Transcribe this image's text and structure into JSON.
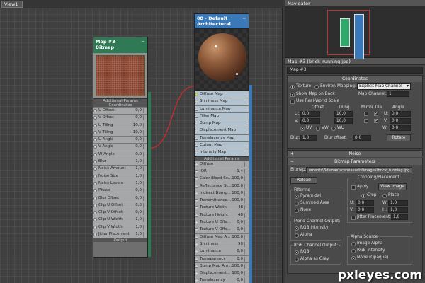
{
  "view": {
    "tab": "View1"
  },
  "bitmap_node": {
    "title": "Map #3",
    "subtitle": "Bitmap",
    "section_params": "Additional Params",
    "section_coords": "Coordinates",
    "section_output": "Output",
    "rows": [
      {
        "label": "U Offset",
        "value": "0,0"
      },
      {
        "label": "V Offset",
        "value": "0,0"
      },
      {
        "label": "U Tiling",
        "value": "10,0"
      },
      {
        "label": "V Tiling",
        "value": "10,0"
      },
      {
        "label": "U Angle",
        "value": "0,0"
      },
      {
        "label": "V Angle",
        "value": "0,0"
      },
      {
        "label": "W Angle",
        "value": "0,0"
      },
      {
        "label": "Blur",
        "value": "1,0"
      },
      {
        "label": "Noise Amount",
        "value": "1,0"
      },
      {
        "label": "Noise Size",
        "value": "1,0"
      },
      {
        "label": "Noise Levels",
        "value": "1,0"
      },
      {
        "label": "Phase",
        "value": "0,0"
      },
      {
        "label": "Blur Offset",
        "value": "0,0"
      },
      {
        "label": "Clip U Offset",
        "value": "0,0"
      },
      {
        "label": "Clip V Offset",
        "value": "0,0"
      },
      {
        "label": "Clip U Width",
        "value": "1,0"
      },
      {
        "label": "Clip V Width",
        "value": "1,0"
      },
      {
        "label": "Jitter Placement",
        "value": "1,0"
      }
    ]
  },
  "material_node": {
    "title": "08 - Default",
    "subtitle": "Architectural",
    "section_params": "Additional Params",
    "maps": [
      "Diffuse Map",
      "Shininess Map",
      "Luminance Map",
      "Filter Map",
      "Bump Map",
      "Displacement Map",
      "Translucency Map",
      "Cutout Map",
      "Intensity Map"
    ],
    "params": [
      {
        "label": "Diffuse",
        "value": ""
      },
      {
        "label": "IOR",
        "value": "1,4"
      },
      {
        "label": "Color Bleed Sc...",
        "value": "100,0"
      },
      {
        "label": "Reflectance Sc...",
        "value": "100,0"
      },
      {
        "label": "Indirect Bump...",
        "value": "100,0"
      },
      {
        "label": "Transmittance...",
        "value": "100,0"
      },
      {
        "label": "Texture Width",
        "value": "48"
      },
      {
        "label": "Texture Height",
        "value": "48"
      },
      {
        "label": "Texture U Offs...",
        "value": "0,0"
      },
      {
        "label": "Texture V Offs...",
        "value": "0,0"
      },
      {
        "label": "Diffuse Map A...",
        "value": "100,0"
      },
      {
        "label": "Shininess",
        "value": "90"
      },
      {
        "label": "Luminance",
        "value": "0,0"
      },
      {
        "label": "Transparency",
        "value": "0,0"
      },
      {
        "label": "Bump Map Am...",
        "value": "100,0"
      },
      {
        "label": "Displacement...",
        "value": "100,0"
      },
      {
        "label": "Translucency",
        "value": "0,0"
      }
    ]
  },
  "panel": {
    "navigator_title": "Navigator",
    "map_title": "Map #3  (brick_running.jpg)",
    "map_name": "Map #3",
    "coords": {
      "head": "Coordinates",
      "texture": "Texture",
      "environ": "Environ",
      "mapping_label": "Mapping:",
      "mapping_value": "Explicit Map Channel",
      "show_map": "Show Map on Back",
      "map_channel_label": "Map Channel:",
      "map_channel": "1",
      "real_world": "Use Real-World Scale",
      "col_offset": "Offset",
      "col_tiling": "Tiling",
      "col_mirror": "Mirror Tile",
      "col_angle": "Angle",
      "u": "U:",
      "v": "V:",
      "w": "W:",
      "u_off": "0,0",
      "v_off": "0,0",
      "u_tile": "10,0",
      "v_tile": "10,0",
      "u_ang": "0,0",
      "v_ang": "0,0",
      "w_ang": "0,0",
      "uv": "UV",
      "vw": "VW",
      "wu": "WU",
      "blur_label": "Blur:",
      "blur": "1,0",
      "blur_off_label": "Blur offset:",
      "blur_off": "0,0",
      "rotate": "Rotate"
    },
    "noise_head": "Noise",
    "bitmap_params_head": "Bitmap Parameters",
    "bitmap_label": "Bitmap:",
    "bitmap_path": "uments\\3dsmax\\sceneassets\\images\\brick_running.jpg",
    "reload": "Reload",
    "cropping": "Cropping/Placement",
    "apply": "Apply",
    "view_image": "View Image",
    "crop": "Crop",
    "place": "Place",
    "cu": "U:",
    "cu_val": "0,0",
    "cw": "W:",
    "cw_val": "1,0",
    "cv": "V:",
    "cv_val": "0,0",
    "ch": "H:",
    "ch_val": "1,0",
    "jitter": "Jitter Placement:",
    "jitter_val": "1,0",
    "filtering": "Filtering",
    "pyramidal": "Pyramidal",
    "summed": "Summed Area",
    "none_f": "None",
    "mono_head": "Mono Channel Output:",
    "rgb_int": "RGB Intensity",
    "alpha": "Alpha",
    "rgb_head": "RGB Channel Output:",
    "rgb": "RGB",
    "alpha_grey": "Alpha as Grey",
    "alpha_src": "Alpha Source",
    "img_alpha": "Image Alpha",
    "rgb_int2": "RGB Intensity",
    "none_opaque": "None (Opaque)"
  },
  "watermark": "pxleyes.com"
}
